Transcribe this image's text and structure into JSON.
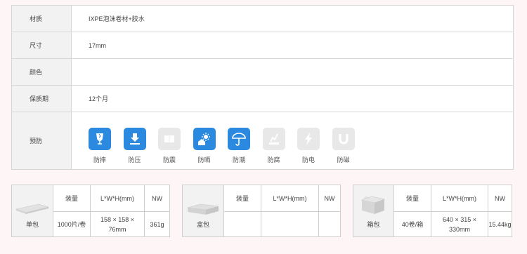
{
  "specs": {
    "material_label": "材质",
    "material_value": "IXPE泡沫卷材+胶水",
    "size_label": "尺寸",
    "size_value": "17mm",
    "color_label": "颜色",
    "color_value": "",
    "shelf_label": "保质期",
    "shelf_value": "12个月",
    "protect_label": "预防"
  },
  "protections": [
    {
      "label": "防摔",
      "icon": "fragile-glass-icon",
      "active": true
    },
    {
      "label": "防压",
      "icon": "pressure-icon",
      "active": true
    },
    {
      "label": "防震",
      "icon": "shock-icon",
      "active": false
    },
    {
      "label": "防晒",
      "icon": "sun-icon",
      "active": true
    },
    {
      "label": "防潮",
      "icon": "umbrella-icon",
      "active": true
    },
    {
      "label": "防腐",
      "icon": "corrosion-icon",
      "active": false
    },
    {
      "label": "防电",
      "icon": "lightning-icon",
      "active": false
    },
    {
      "label": "防磁",
      "icon": "magnet-icon",
      "active": false
    }
  ],
  "colors": {
    "active": "#2b8ae0",
    "inactive": "#e8e8e8"
  },
  "packages": [
    {
      "name": "单包",
      "qty_header": "装量",
      "dim_header": "L*W*H(mm)",
      "nw_header": "NW",
      "qty": "1000片/卷",
      "dim": "158 × 158 × 76mm",
      "nw": "361g"
    },
    {
      "name": "盒包",
      "qty_header": "装量",
      "dim_header": "L*W*H(mm)",
      "nw_header": "NW",
      "qty": "",
      "dim": "",
      "nw": ""
    },
    {
      "name": "箱包",
      "qty_header": "装量",
      "dim_header": "L*W*H(mm)",
      "nw_header": "NW",
      "qty": "40卷/箱",
      "dim": "640 × 315 × 330mm",
      "nw": "15.44kg"
    }
  ]
}
